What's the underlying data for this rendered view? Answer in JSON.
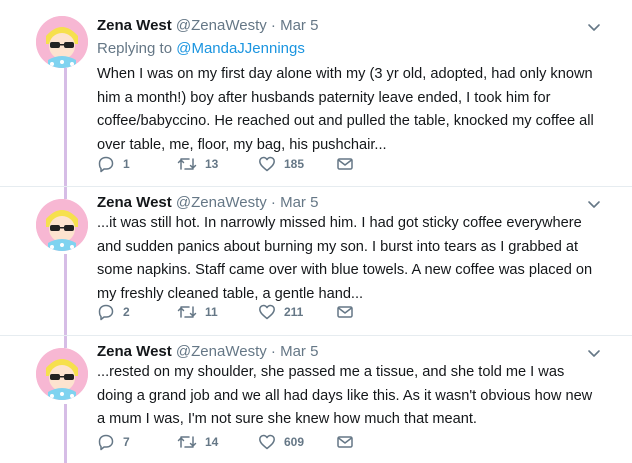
{
  "tweets": [
    {
      "name": "Zena West",
      "handle": "@ZenaWesty",
      "separator": "·",
      "date": "Mar 5",
      "replying_prefix": "Replying to ",
      "replying_to": "@MandaJJennings",
      "text": "When I was on my first day alone with my (3 yr old, adopted, had only known him a month!) boy after husbands paternity leave ended, I took him for coffee/babyccino. He reached out and pulled the table, knocked my coffee all over table, me, floor, my bag, his pushchair...",
      "replies": "1",
      "retweets": "13",
      "likes": "185"
    },
    {
      "name": "Zena West",
      "handle": "@ZenaWesty",
      "separator": "·",
      "date": "Mar 5",
      "text": "...it was still hot. In narrowly missed him. I had got sticky coffee everywhere and sudden panics about burning my son. I burst into tears as I grabbed at some napkins. Staff came over with blue towels. A new coffee was placed on my freshly cleaned table, a gentle hand...",
      "replies": "2",
      "retweets": "11",
      "likes": "211"
    },
    {
      "name": "Zena West",
      "handle": "@ZenaWesty",
      "separator": "·",
      "date": "Mar 5",
      "text": "...rested on my shoulder, she passed me a tissue, and she told me I was doing a grand job and we all had days like this. As it wasn't obvious how new a mum I was, I'm not sure she knew how much that meant.",
      "replies": "7",
      "retweets": "14",
      "likes": "609"
    }
  ],
  "colors": {
    "thread_line": "#d6bde6",
    "link": "#1b95e0",
    "muted": "#657786",
    "avatar_bg": "#f7b7d3"
  },
  "icons": [
    "reply-icon",
    "retweet-icon",
    "like-icon",
    "message-icon",
    "chevron-down-icon"
  ]
}
